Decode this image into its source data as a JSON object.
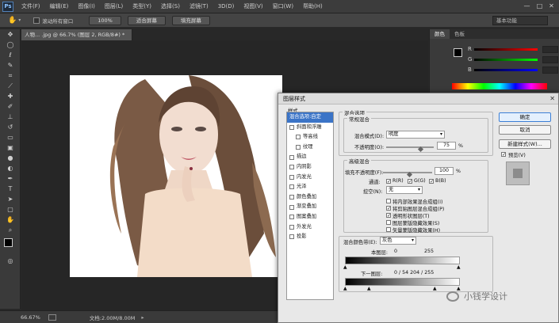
{
  "menubar": {
    "logo": "Ps",
    "items": [
      "文件(F)",
      "编辑(E)",
      "图像(I)",
      "图层(L)",
      "类型(Y)",
      "选择(S)",
      "滤镜(T)",
      "3D(D)",
      "视图(V)",
      "窗口(W)",
      "帮助(H)"
    ]
  },
  "options": {
    "scroll_all_label": "滚动所有窗口",
    "zoom_100": "100%",
    "fit_screen": "适合屏幕",
    "fill_screen": "填充屏幕",
    "workspace": "基本功能"
  },
  "document": {
    "tab_title": "人物... .jpg @ 66.7% (图层 2, RGB/8#) *"
  },
  "status": {
    "zoom": "66.67%",
    "doc_info": "文档:2.00M/8.00M"
  },
  "color_panel": {
    "tab_color": "颜色",
    "tab_swatches": "色板",
    "r": "R",
    "g": "G",
    "b": "B"
  },
  "dialog": {
    "title": "图层样式",
    "styles_header": "样式",
    "style_items": [
      {
        "label": "混合选项:自定",
        "checkbox": false,
        "selected": true,
        "indent": false
      },
      {
        "label": "斜面和浮雕",
        "checkbox": true,
        "selected": false,
        "indent": false
      },
      {
        "label": "等高线",
        "checkbox": true,
        "selected": false,
        "indent": true
      },
      {
        "label": "纹理",
        "checkbox": true,
        "selected": false,
        "indent": true
      },
      {
        "label": "描边",
        "checkbox": true,
        "selected": false,
        "indent": false
      },
      {
        "label": "内阴影",
        "checkbox": true,
        "selected": false,
        "indent": false
      },
      {
        "label": "内发光",
        "checkbox": true,
        "selected": false,
        "indent": false
      },
      {
        "label": "光泽",
        "checkbox": true,
        "selected": false,
        "indent": false
      },
      {
        "label": "颜色叠加",
        "checkbox": true,
        "selected": false,
        "indent": false
      },
      {
        "label": "渐变叠加",
        "checkbox": true,
        "selected": false,
        "indent": false
      },
      {
        "label": "图案叠加",
        "checkbox": true,
        "selected": false,
        "indent": false
      },
      {
        "label": "外发光",
        "checkbox": true,
        "selected": false,
        "indent": false
      },
      {
        "label": "投影",
        "checkbox": true,
        "selected": false,
        "indent": false
      }
    ],
    "blend_options_title": "混合选项",
    "general_blend": "常规混合",
    "blend_mode_label": "混合模式(D):",
    "blend_mode_value": "明度",
    "opacity_label": "不透明度(O):",
    "opacity_value": "75",
    "percent": "%",
    "advanced_blend": "高级混合",
    "fill_opacity_label": "填充不透明度(F):",
    "fill_opacity_value": "100",
    "channels_label": "通道:",
    "channel_r": "R(R)",
    "channel_g": "G(G)",
    "channel_b": "B(B)",
    "knockout_label": "挖空(N):",
    "knockout_value": "无",
    "options": [
      {
        "label": "将内部效果混合成组(I)",
        "checked": false
      },
      {
        "label": "将剪贴图层混合成组(P)",
        "checked": true
      },
      {
        "label": "透明形状图层(T)",
        "checked": true
      },
      {
        "label": "图层蒙版隐藏效果(S)",
        "checked": false
      },
      {
        "label": "矢量蒙版隐藏效果(H)",
        "checked": false
      }
    ],
    "blend_if_label": "混合颜色带(E):",
    "blend_if_value": "灰色",
    "this_layer_label": "本图层:",
    "this_layer_min": "0",
    "this_layer_max": "255",
    "underlying_label": "下一图层:",
    "underlying_values": "0 / 54    204 / 255",
    "ok": "确定",
    "cancel": "取消",
    "new_style": "新建样式(W)...",
    "preview_label": "预览(V)"
  },
  "watermark": "小钱学设计"
}
